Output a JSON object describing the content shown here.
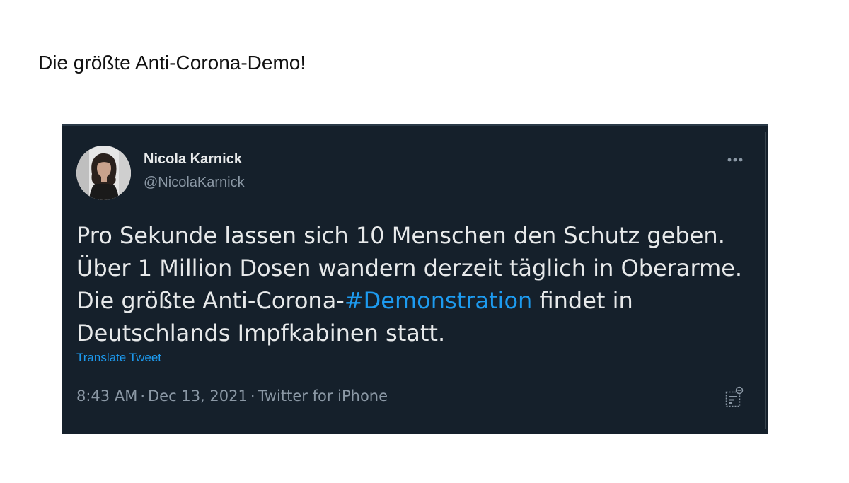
{
  "page": {
    "heading": "Die größte Anti-Corona-Demo!"
  },
  "tweet": {
    "author_name": "Nicola Karnick",
    "author_handle": "@NicolaKarnick",
    "text_lines": [
      "Pro Sekunde lassen sich 10 Menschen den Schutz geben.",
      "Über 1 Million Dosen wandern derzeit täglich in Oberarme.",
      "Die größte Anti-Corona-",
      "#Demonstration",
      " findet in",
      "Deutschlands Impfkabinen statt."
    ],
    "translate_label": "Translate Tweet",
    "time": "8:43 AM",
    "date": "Dec 13, 2021",
    "source": "Twitter for iPhone",
    "separator": "·",
    "more_icon": "more-dots-icon",
    "analytics_icon": "analytics-icon"
  },
  "colors": {
    "card_background": "#15202b",
    "text_primary": "#e7e9ea",
    "text_secondary": "#8b98a5",
    "accent": "#1d9bf0"
  }
}
